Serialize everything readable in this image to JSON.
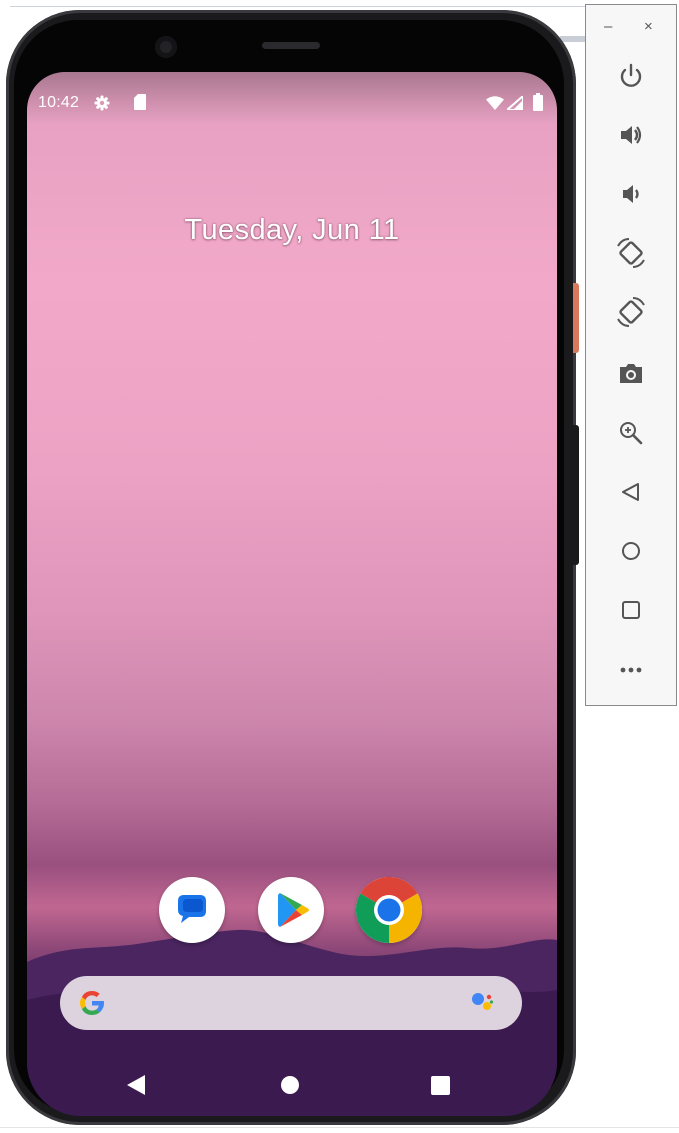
{
  "status_bar": {
    "time": "10:42",
    "icons": [
      "gear-icon",
      "sd-card-icon",
      "wifi-icon",
      "signal-icon",
      "battery-icon"
    ]
  },
  "lock_screen": {
    "date": "Tuesday, Jun 11"
  },
  "dock": {
    "apps": [
      {
        "name": "Messages",
        "icon": "messages-icon"
      },
      {
        "name": "Play Store",
        "icon": "play-store-icon"
      },
      {
        "name": "Chrome",
        "icon": "chrome-icon"
      }
    ]
  },
  "search_bar": {
    "icons": [
      "google-g-icon",
      "google-assistant-icon"
    ]
  },
  "navigation": {
    "buttons": [
      "back-icon",
      "home-icon",
      "recents-icon"
    ]
  },
  "emulator_panel": {
    "minimize_label": "–",
    "close_label": "×",
    "buttons": [
      "power-icon",
      "volume-up-icon",
      "volume-down-icon",
      "rotate-left-icon",
      "rotate-right-icon",
      "camera-icon",
      "zoom-icon",
      "back-icon",
      "home-icon",
      "overview-icon",
      "more-icon"
    ]
  },
  "colors": {
    "wallpaper_top": "#f2a9c9",
    "wallpaper_bottom": "#2a1238",
    "search_bar": "#ddd3df",
    "messages_blue": "#1a73e8",
    "power_button_accent": "#d9795c"
  }
}
